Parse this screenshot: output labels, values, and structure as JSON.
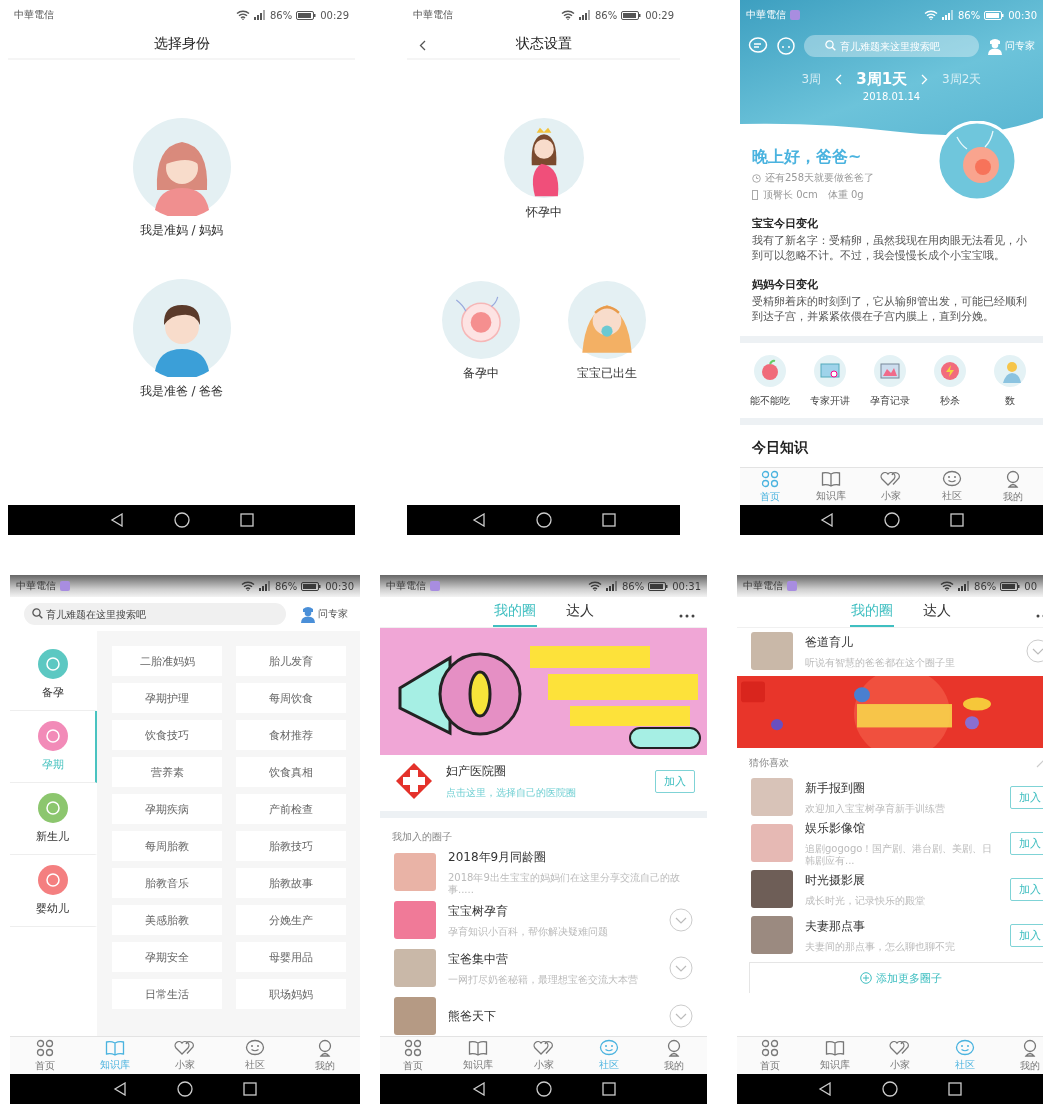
{
  "screens": [
    {
      "kind": "identity",
      "status_bar": {
        "carrier": "中華電信",
        "badge": false,
        "battery": "86%",
        "time": "00:29"
      },
      "title": "选择身份",
      "options": [
        {
          "label": "我是准妈 / 妈妈"
        },
        {
          "label": "我是准爸 / 爸爸"
        }
      ]
    },
    {
      "kind": "stage",
      "status_bar": {
        "carrier": "中華電信",
        "badge": false,
        "battery": "86%",
        "time": "00:29"
      },
      "back": true,
      "title": "状态设置",
      "options": [
        {
          "label": "怀孕中"
        },
        {
          "label": "备孕中"
        },
        {
          "label": "宝宝已出生"
        }
      ]
    },
    {
      "kind": "home",
      "status_bar": {
        "carrier": "中華電信",
        "badge": true,
        "battery": "86%",
        "time": "00:30"
      },
      "search": {
        "placeholder": "育儿难题来这里搜索吧"
      },
      "ask_expert": "问专家",
      "week_nav": {
        "previous": "3周",
        "current": "3周1天",
        "next": "3周2天",
        "date": "2018.01.14"
      },
      "greeting": "晚上好，爸爸~",
      "countdown": "还有258天就要做爸爸了",
      "measurements": [
        "顶臀长 0cm",
        "体重 0g"
      ],
      "changes": [
        {
          "heading": "宝宝今日变化",
          "body": "我有了新名字：受精卵，虽然我现在用肉眼无法看见，小到可以忽略不计。不过，我会慢慢长成个小宝宝哦。"
        },
        {
          "heading": "妈妈今日变化",
          "body": "受精卵着床的时刻到了，它从输卵管出发，可能已经顺利到达子宫，并紧紧依偎在子宫内膜上，直到分娩。"
        }
      ],
      "shortcuts": [
        {
          "label": "能不能吃"
        },
        {
          "label": "专家开讲"
        },
        {
          "label": "孕育记录"
        },
        {
          "label": "秒杀"
        },
        {
          "label": "数"
        }
      ],
      "knowledge_heading": "今日知识",
      "tab_bar": [
        {
          "label": "首页",
          "selected": true
        },
        {
          "label": "知识库",
          "selected": false
        },
        {
          "label": "小家",
          "selected": false
        },
        {
          "label": "社区",
          "selected": false
        },
        {
          "label": "我的",
          "selected": false
        }
      ]
    },
    {
      "kind": "library",
      "status_bar": {
        "carrier": "中華電信",
        "badge": true,
        "battery": "86%",
        "time": "00:30"
      },
      "search": {
        "placeholder": "育儿难题在这里搜索吧"
      },
      "ask_expert": "问专家",
      "categories": [
        {
          "label": "备孕",
          "color": "#5cc8c2",
          "selected": false
        },
        {
          "label": "孕期",
          "color": "#f28bb8",
          "selected": true
        },
        {
          "label": "新生儿",
          "color": "#8cc66e",
          "selected": false
        },
        {
          "label": "婴幼儿",
          "color": "#f47f80",
          "selected": false
        }
      ],
      "topics": [
        "二胎准妈妈",
        "胎儿发育",
        "孕期护理",
        "每周饮食",
        "饮食技巧",
        "食材推荐",
        "营养素",
        "饮食真相",
        "孕期疾病",
        "产前检查",
        "每周胎教",
        "胎教技巧",
        "胎教音乐",
        "胎教故事",
        "美感胎教",
        "分娩生产",
        "孕期安全",
        "母婴用品",
        "日常生活",
        "职场妈妈"
      ],
      "tab_bar": [
        {
          "label": "首页",
          "selected": false
        },
        {
          "label": "知识库",
          "selected": true
        },
        {
          "label": "小家",
          "selected": false
        },
        {
          "label": "社区",
          "selected": false
        },
        {
          "label": "我的",
          "selected": false
        }
      ]
    },
    {
      "kind": "community",
      "status_bar": {
        "carrier": "中華電信",
        "badge": true,
        "battery": "86%",
        "time": "00:31"
      },
      "tabs": [
        {
          "label": "我的圈",
          "selected": true
        },
        {
          "label": "达人",
          "selected": false
        }
      ],
      "hospital": {
        "title": "妇产医院圈",
        "hint": "点击这里，选择自己的医院圈",
        "join": "加入"
      },
      "section_label": "我加入的圈子",
      "circles": [
        {
          "name": "2018年9月同龄圈",
          "description": "2018年9出生宝宝的妈妈们在这里分享交流自己的故事.....",
          "expandable": false
        },
        {
          "name": "宝宝树孕育",
          "description": "孕育知识小百科，帮你解决疑难问题",
          "expandable": true
        },
        {
          "name": "宝爸集中营",
          "description": "一网打尽奶爸秘籍，最理想宝爸交流大本营",
          "expandable": true
        },
        {
          "name": "熊爸天下",
          "expandable": true
        }
      ],
      "tab_bar": [
        {
          "label": "首页",
          "selected": false
        },
        {
          "label": "知识库",
          "selected": false
        },
        {
          "label": "小家",
          "selected": false
        },
        {
          "label": "社区",
          "selected": true
        },
        {
          "label": "我的",
          "selected": false
        }
      ]
    },
    {
      "kind": "discover",
      "status_bar": {
        "carrier": "中華電信",
        "badge": true,
        "battery": "86%",
        "time": "00"
      },
      "tabs": [
        {
          "label": "我的圈",
          "selected": true
        },
        {
          "label": "达人",
          "selected": false
        }
      ],
      "circles": [
        {
          "name": "爸道育儿",
          "description": "听说有智慧的爸爸都在这个圈子里",
          "expandable": true
        }
      ],
      "section_label": "猜你喜欢",
      "suggestions": [
        {
          "name": "新手报到圈",
          "description": "欢迎加入宝宝树孕育新手训练营",
          "join": "加入"
        },
        {
          "name": "娱乐影像馆",
          "description": "追剧gogogo！国产剧、港台剧、美剧、日韩剧应有...",
          "join": "加入"
        },
        {
          "name": "时光摄影展",
          "description": "成长时光，记录快乐的殿堂",
          "join": "加入"
        },
        {
          "name": "夫妻那点事",
          "description": "夫妻间的那点事，怎么聊也聊不完",
          "join": "加入"
        }
      ],
      "add_more": "添加更多圈子",
      "tab_bar": [
        {
          "label": "首页",
          "selected": false
        },
        {
          "label": "知识库",
          "selected": false
        },
        {
          "label": "小家",
          "selected": false
        },
        {
          "label": "社区",
          "selected": true
        },
        {
          "label": "我的",
          "selected": false
        }
      ]
    }
  ]
}
